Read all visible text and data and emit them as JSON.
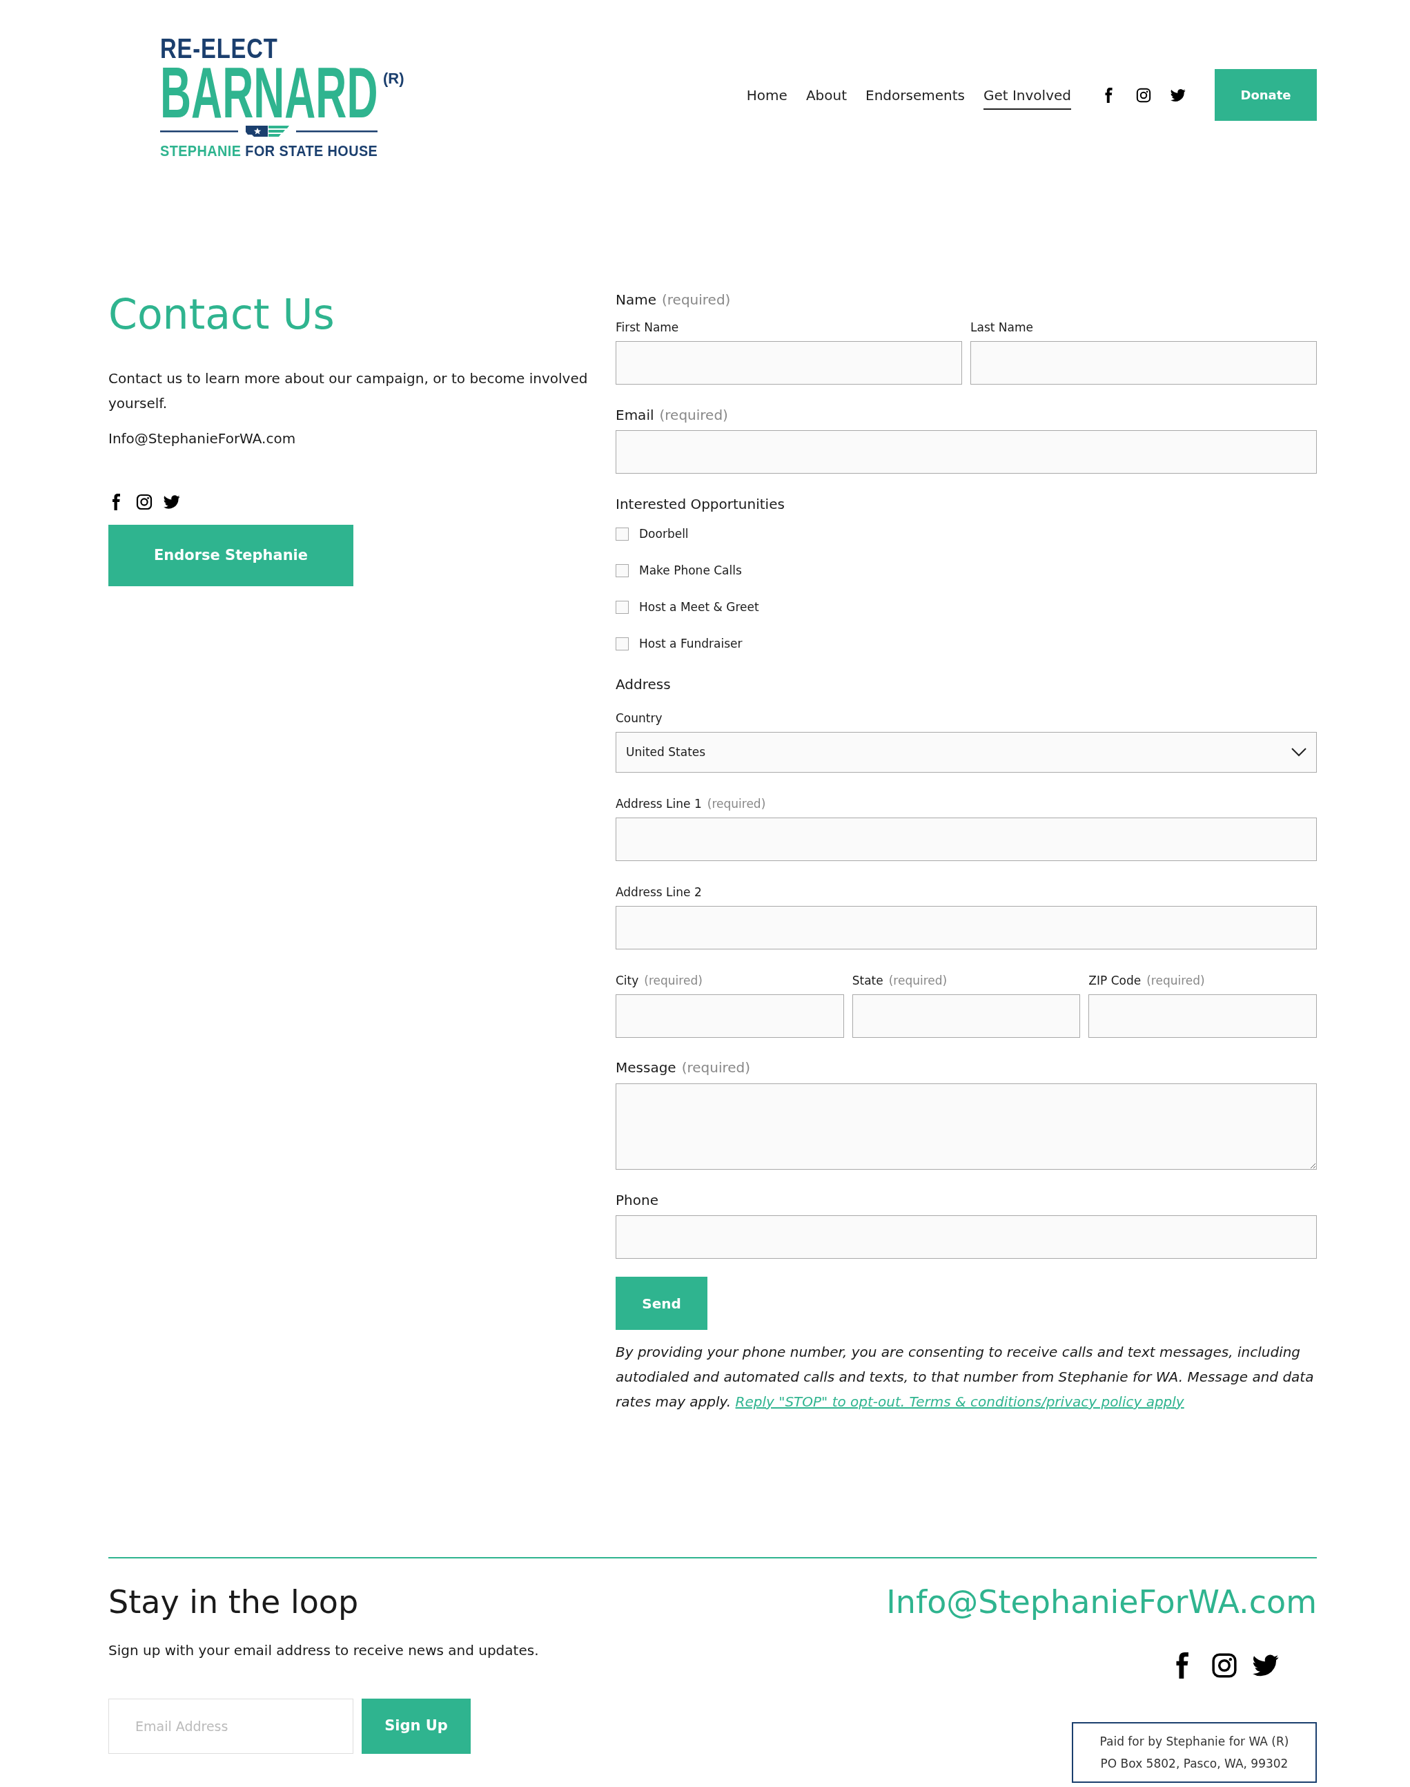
{
  "header": {
    "logo": {
      "top_line": "RE-ELECT",
      "name": "BARNARD",
      "mark": "(R)",
      "tagline_first": "STEPHANIE",
      "tagline_rest": "FOR STATE HOUSE"
    },
    "nav": [
      {
        "label": "Home",
        "selected": false
      },
      {
        "label": "About",
        "selected": false
      },
      {
        "label": "Endorsements",
        "selected": false
      },
      {
        "label": "Get Involved",
        "selected": true
      }
    ],
    "donate_button": "Donate"
  },
  "contact": {
    "title": "Contact Us",
    "text": "Contact us to learn more about our campaign, or to become involved yourself.",
    "email": "Info@StephanieForWA.com",
    "button": "Endorse Stephanie"
  },
  "form": {
    "fields": [
      {
        "kind": "name",
        "label": "Name",
        "note": "(required)",
        "parts": [
          {
            "label": "First Name"
          },
          {
            "label": "Last Name"
          }
        ]
      },
      {
        "kind": "input",
        "label": "Email",
        "note": "(required)"
      },
      {
        "kind": "checkboxes",
        "label": "Interested Opportunities",
        "options": [
          {
            "label": "Doorbell",
            "checked": false
          },
          {
            "label": "Make Phone Calls",
            "checked": false
          },
          {
            "label": "Host a Meet & Greet",
            "checked": false
          },
          {
            "label": "Host a Fundraiser",
            "checked": false
          }
        ]
      },
      {
        "kind": "heading",
        "label": "Address"
      },
      {
        "kind": "select",
        "label": "Country",
        "value": "United States"
      },
      {
        "kind": "subinput",
        "label": "Address Line 1",
        "note": "(required)"
      },
      {
        "kind": "subinput",
        "label": "Address Line 2"
      },
      {
        "kind": "row",
        "parts": [
          {
            "label": "City",
            "note": "(required)"
          },
          {
            "label": "State",
            "note": "(required)"
          },
          {
            "label": "ZIP Code",
            "note": "(required)"
          }
        ]
      },
      {
        "kind": "textarea",
        "label": "Message",
        "note": "(required)"
      },
      {
        "kind": "input",
        "label": "Phone"
      }
    ],
    "send_button": "Send",
    "disclaimer": "By providing your phone number, you are consenting to receive calls and text messages, including autodialed and automated calls and texts, to that number from Stephanie for WA. Message and data rates may apply.",
    "disclaimer_link": "Reply \"STOP\" to opt-out. Terms & conditions/privacy policy apply"
  },
  "footer": {
    "title": "Stay in the loop",
    "text": "Sign up with your email address to receive news and updates.",
    "email_placeholder": "Email Address",
    "signup_button": "Sign Up",
    "email": "Info@StephanieForWA.com",
    "paid_lines": [
      "Paid for by Stephanie for WA (R)",
      "PO Box 5802, Pasco, WA, 99302"
    ]
  }
}
